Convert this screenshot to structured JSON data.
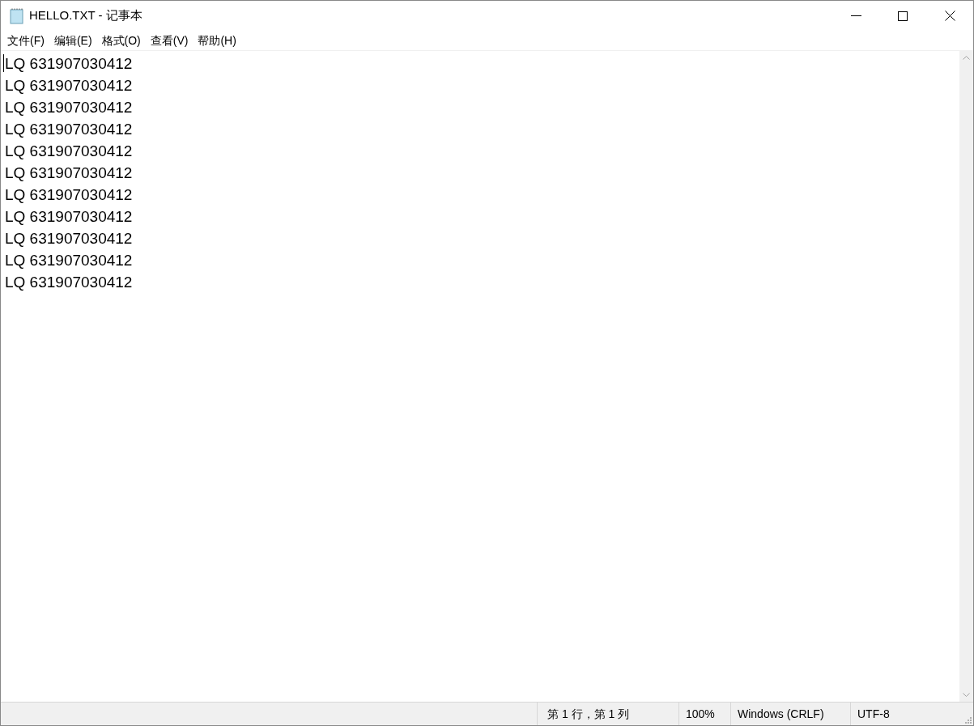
{
  "window": {
    "title": "HELLO.TXT - 记事本"
  },
  "menu": [
    "文件(F)",
    "编辑(E)",
    "格式(O)",
    "查看(V)",
    "帮助(H)"
  ],
  "editor": {
    "lines": [
      "LQ 631907030412",
      "LQ 631907030412",
      "LQ 631907030412",
      "LQ 631907030412",
      "LQ 631907030412",
      "LQ 631907030412",
      "LQ 631907030412",
      "LQ 631907030412",
      "LQ 631907030412",
      "LQ 631907030412",
      "LQ 631907030412"
    ]
  },
  "status_bar": {
    "position": "第 1 行，第 1 列",
    "zoom": "100%",
    "line_ending": "Windows (CRLF)",
    "encoding": "UTF-8"
  }
}
